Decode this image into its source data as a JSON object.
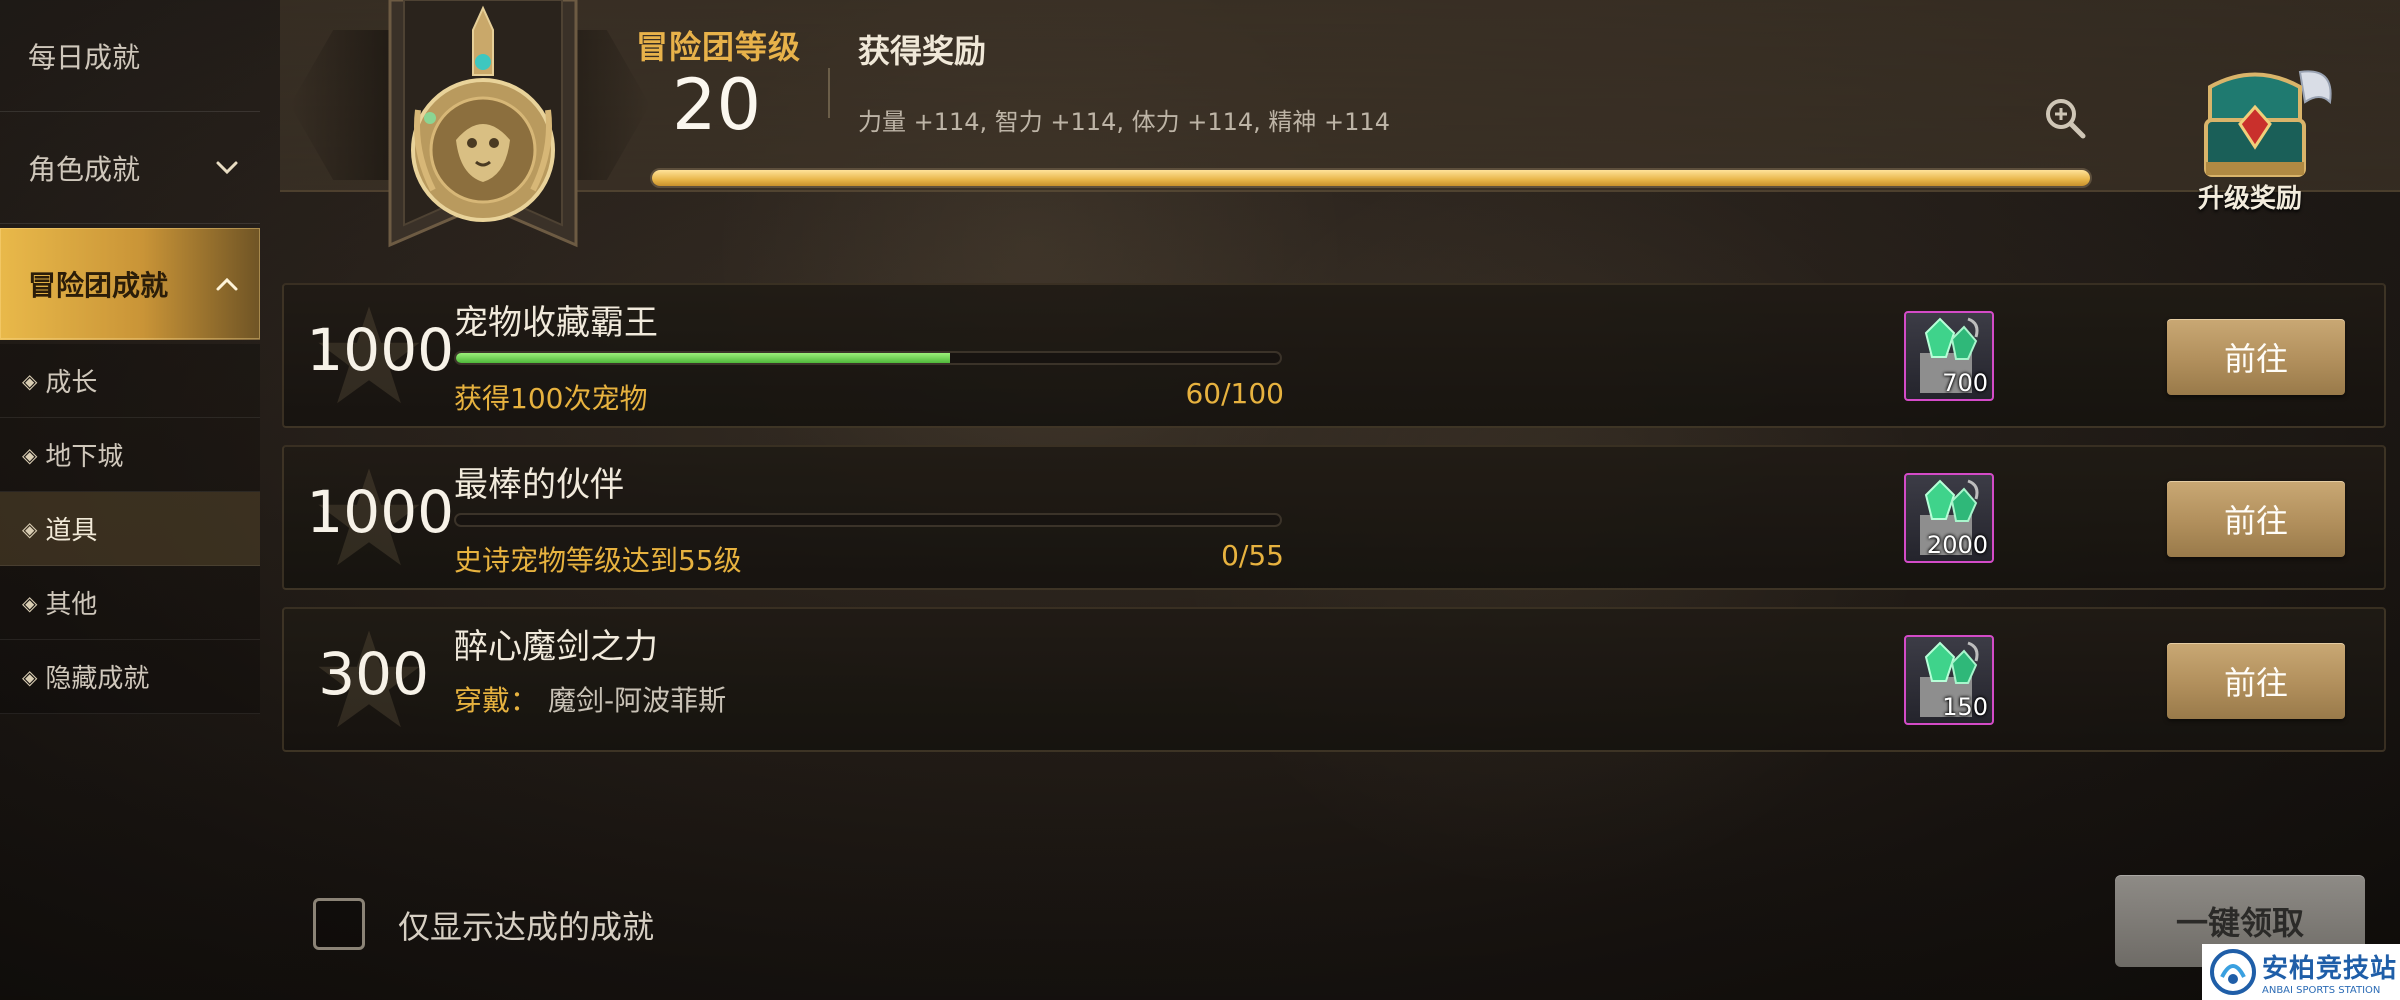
{
  "sidebar": {
    "items": [
      {
        "label": "每日成就"
      },
      {
        "label": "角色成就"
      },
      {
        "label": "冒险团成就"
      }
    ],
    "sub_items": [
      {
        "label": "成长"
      },
      {
        "label": "地下城"
      },
      {
        "label": "道具"
      },
      {
        "label": "其他"
      },
      {
        "label": "隐藏成就"
      }
    ],
    "active": "冒险团成就",
    "selected_sub": "道具"
  },
  "header": {
    "level_title": "冒险团等级",
    "level": "20",
    "reward_title": "获得奖励",
    "reward_stats": "力量 +114, 智力 +114, 体力 +114, 精神 +114",
    "level_progress": 1.0,
    "upgrade_reward_label": "升级奖励"
  },
  "achievements": [
    {
      "points": "1000",
      "title": "宠物收藏霸王",
      "desc": "获得100次宠物",
      "count": "60/100",
      "progress": 0.6,
      "reward_qty": "700",
      "button": "前往"
    },
    {
      "points": "1000",
      "title": "最棒的伙伴",
      "desc": "史诗宠物等级达到55级",
      "count": "0/55",
      "progress": 0.0,
      "reward_qty": "2000",
      "button": "前往"
    },
    {
      "points": "300",
      "title": "醉心魔剑之力",
      "desc": "穿戴：",
      "desc_value": "魔剑-阿波菲斯",
      "reward_qty": "150",
      "button": "前往"
    }
  ],
  "footer": {
    "checkbox_label": "仅显示达成的成就",
    "checkbox_checked": false,
    "claim_all": "一键领取"
  },
  "watermark": {
    "cn": "安柏竞技站",
    "en": "ANBAI SPORTS STATION"
  },
  "colors": {
    "accent": "#e8b24a",
    "progress_green": "#4fb83a",
    "item_border": "#d44bc8"
  }
}
